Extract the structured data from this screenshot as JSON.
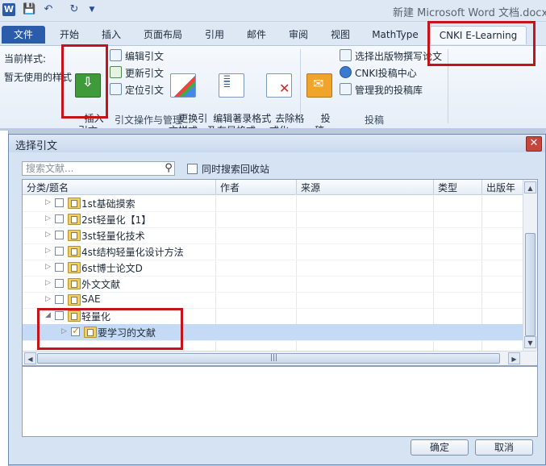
{
  "titlebar": {
    "app_icon_glyph": "W",
    "document_title": "新建 Microsoft Word 文档.docx"
  },
  "tabs": [
    {
      "id": "file",
      "label": "文件"
    },
    {
      "id": "home",
      "label": "开始"
    },
    {
      "id": "insert",
      "label": "插入"
    },
    {
      "id": "layout",
      "label": "页面布局"
    },
    {
      "id": "references",
      "label": "引用"
    },
    {
      "id": "mailings",
      "label": "邮件"
    },
    {
      "id": "review",
      "label": "审阅"
    },
    {
      "id": "view",
      "label": "视图"
    },
    {
      "id": "mathtype",
      "label": "MathType"
    },
    {
      "id": "cnki",
      "label": "CNKI E-Learning"
    }
  ],
  "ribbon": {
    "current_style_label": "当前样式:",
    "current_style_value": "暂无使用的样式",
    "insert_citation": "插入\n引文",
    "edit_citation": "编辑引文",
    "update_citation": "更新引文",
    "locate_citation": "定位引文",
    "change_style": "更换引\n文样式",
    "edit_bib_format": "编辑著录格式\n及布局格式",
    "remove_format": "去除格\n式化",
    "group_citation": "引文操作与管理",
    "submit": "投\n稿",
    "select_journal": "选择出版物撰写论文",
    "cnki_submission_center": "CNKI投稿中心",
    "manage_submissions": "管理我的投稿库",
    "group_submit": "投稿"
  },
  "dialog": {
    "title": "选择引文",
    "search_placeholder": "搜索文献...",
    "recycle_label": "同时搜索回收站",
    "columns": [
      "分类/题名",
      "作者",
      "来源",
      "类型",
      "出版年"
    ],
    "rows": [
      {
        "label": "1st基础摸索",
        "level": 1,
        "checked": false,
        "expanded": false,
        "selected": false
      },
      {
        "label": "2st轻量化【1】",
        "level": 1,
        "checked": false,
        "expanded": false,
        "selected": false
      },
      {
        "label": "3st轻量化技术",
        "level": 1,
        "checked": false,
        "expanded": false,
        "selected": false
      },
      {
        "label": "4st结构轻量化设计方法",
        "level": 1,
        "checked": false,
        "expanded": false,
        "selected": false
      },
      {
        "label": "6st博士论文D",
        "level": 1,
        "checked": false,
        "expanded": false,
        "selected": false
      },
      {
        "label": "外文文献",
        "level": 1,
        "checked": false,
        "expanded": false,
        "selected": false
      },
      {
        "label": "SAE",
        "level": 1,
        "checked": false,
        "expanded": false,
        "selected": false
      },
      {
        "label": "轻量化",
        "level": 1,
        "checked": false,
        "expanded": true,
        "selected": false
      },
      {
        "label": "要学习的文献",
        "level": 2,
        "checked": true,
        "expanded": false,
        "selected": true
      }
    ],
    "ok_label": "确定",
    "cancel_label": "取消"
  },
  "colors": {
    "accent": "#2a5caa",
    "annotation_red": "#c4131a",
    "selection": "#c5dbf5"
  }
}
